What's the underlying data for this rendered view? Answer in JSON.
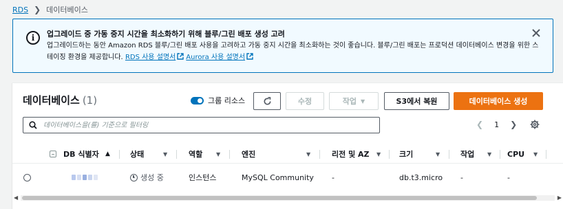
{
  "breadcrumb": {
    "root": "RDS",
    "current": "데이터베이스"
  },
  "alert": {
    "title": "업그레이드 중 가동 중지 시간을 최소화하기 위해 블루/그린 배포 생성 고려",
    "body": "업그레이드하는 동안 Amazon RDS 블루/그린 배포 사용을 고려하고 가동 중지 시간을 최소화하는 것이 좋습니다. 블루/그린 배포는 프로덕션 데이터베이스 변경을 위한 스테이징 환경을 제공합니다.",
    "link1": "RDS 사용 설명서",
    "link2": "Aurora 사용 설명서"
  },
  "panel": {
    "title": "데이터베이스",
    "count": "(1)",
    "group_toggle_label": "그룹 리소스",
    "group_toggle_on": true,
    "edit_label": "수정",
    "actions_label": "작업",
    "restore_s3_label": "S3에서 복원",
    "create_label": "데이터베이스 생성",
    "search_placeholder": "데이터베이스을(를) 기준으로 필터링",
    "page_number": "1"
  },
  "table": {
    "columns": [
      "DB 식별자",
      "상태",
      "역할",
      "엔진",
      "리전 및 AZ",
      "크기",
      "작업",
      "CPU"
    ],
    "rows": [
      {
        "status": "생성 중",
        "role": "인스턴스",
        "engine": "MySQL Community",
        "region": "-",
        "size": "db.t3.micro",
        "actions": "-",
        "cpu": "-"
      }
    ]
  },
  "colors": {
    "accent": "#0073bb",
    "primary_button": "#ec7211",
    "alert_bg": "#f1faff"
  },
  "icons": [
    "info-icon",
    "close-icon",
    "external-link-icon",
    "refresh-icon",
    "search-icon",
    "settings-icon"
  ]
}
